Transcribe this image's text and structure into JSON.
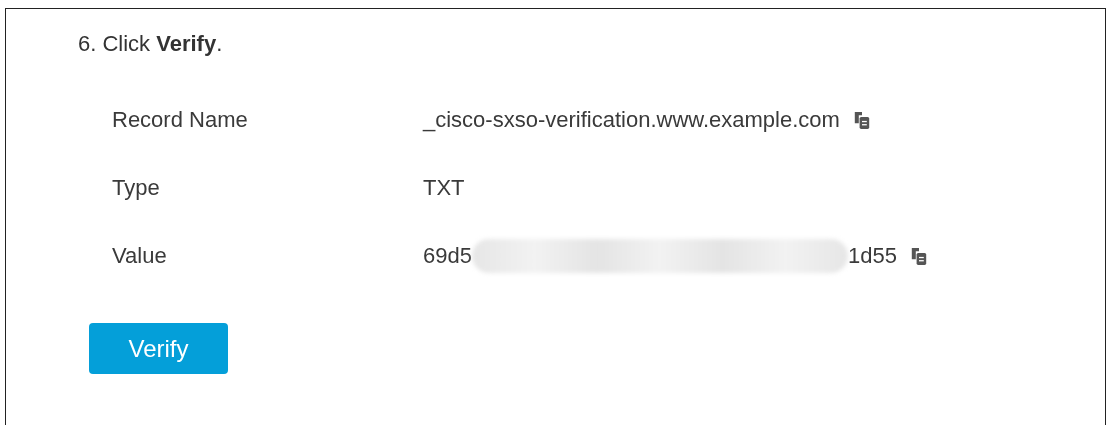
{
  "step": {
    "text": "6. Click **Verify**."
  },
  "fields": [
    {
      "label": "Record Name",
      "kind": "text",
      "value": "_cisco-sxso-verification.www.example.com",
      "copyable": true
    },
    {
      "label": "Type",
      "kind": "text",
      "value": "TXT",
      "copyable": false
    },
    {
      "label": "Value",
      "kind": "redacted",
      "value_start": "69d5",
      "value_end": "1d55",
      "copyable": true
    }
  ],
  "button": {
    "label": "Verify"
  }
}
